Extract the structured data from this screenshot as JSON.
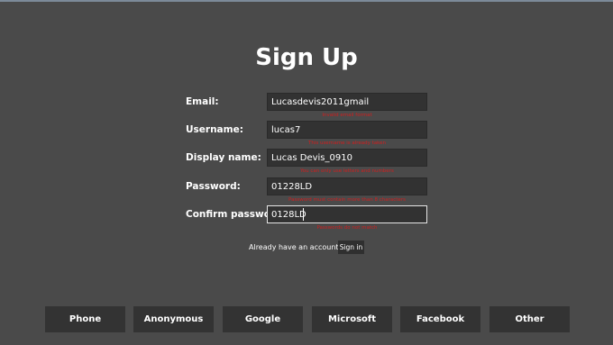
{
  "title": "Sign Up",
  "fields": [
    {
      "label": "Email:",
      "value": "Lucasdevis2011gmail",
      "error": "Invalid email format"
    },
    {
      "label": "Username:",
      "value": "lucas7",
      "error": "This username is already taken"
    },
    {
      "label": "Display name:",
      "value": "Lucas Devis_0910",
      "error": "You can only use letters and numbers"
    },
    {
      "label": "Password:",
      "value": "01228LD",
      "error": "Password must contain more than 8 characters"
    },
    {
      "label": "Confirm password:",
      "value": "0128LD",
      "error": "Passwords do not match"
    }
  ],
  "signin": {
    "text": "Already have an account?",
    "button": "Sign in"
  },
  "providers": [
    "Phone",
    "Anonymous",
    "Google",
    "Microsoft",
    "Facebook",
    "Other"
  ],
  "colors": {
    "background": "#4a4a4a",
    "field": "#323232",
    "error": "#d21e1e",
    "button": "#333333"
  }
}
